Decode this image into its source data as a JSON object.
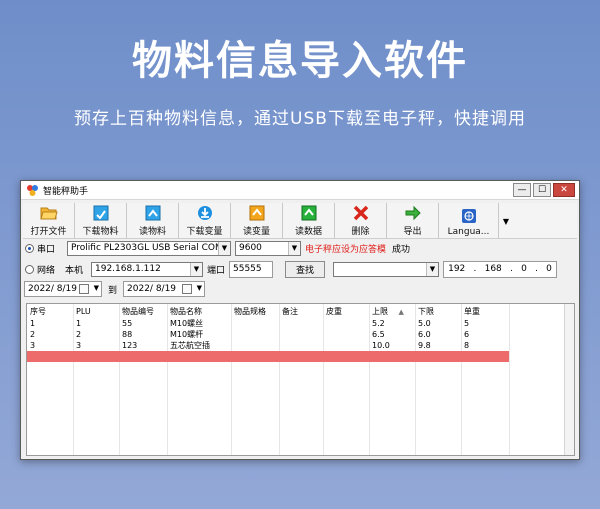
{
  "hero": {
    "title": "物料信息导入软件",
    "subtitle": "预存上百种物料信息，通过USB下载至电子秤，快捷调用"
  },
  "window": {
    "title": "智能秤助手",
    "min_symbol": "—",
    "max_symbol": "☐",
    "close_symbol": "✕"
  },
  "toolbar": {
    "items": [
      {
        "label": "打开文件",
        "icon": "folder-open-icon"
      },
      {
        "label": "下载物料",
        "icon": "download-item-icon"
      },
      {
        "label": "读物料",
        "icon": "read-item-icon"
      },
      {
        "label": "下载变量",
        "icon": "download-variable-icon"
      },
      {
        "label": "读变量",
        "icon": "read-variable-icon"
      },
      {
        "label": "读数据",
        "icon": "read-data-icon"
      },
      {
        "label": "删除",
        "icon": "delete-icon"
      },
      {
        "label": "导出",
        "icon": "export-icon"
      },
      {
        "label": "Langua...",
        "icon": "language-icon"
      }
    ],
    "more_symbol": "▼"
  },
  "serial": {
    "label": "串口",
    "port": "Prolific PL2303GL USB Serial COM Port (",
    "baud": "9600",
    "status_red": "电子秤应设为应答模",
    "status_ok": "成功"
  },
  "network": {
    "label": "网络",
    "local_label": "本机",
    "local_ip": "192.168.1.112",
    "port_label": "端口",
    "port_value": "55555",
    "find_label": "查找",
    "remote_combo": "",
    "ip_parts": [
      "192",
      "168",
      "0",
      "0"
    ]
  },
  "dates": {
    "from": "2022/  8/19",
    "to_label": "到",
    "to": "2022/  8/19"
  },
  "table": {
    "columns": [
      "序号",
      "PLU",
      "物品编号",
      "物品名称",
      "物品规格",
      "备注",
      "皮重",
      "上限",
      "下限",
      "单重"
    ],
    "sort_mark": "▲",
    "rows": [
      [
        "1",
        "1",
        "55",
        "M10螺丝",
        "",
        "",
        "",
        "5.2",
        "5.0",
        "5"
      ],
      [
        "2",
        "2",
        "88",
        "M10螺杆",
        "",
        "",
        "",
        "6.5",
        "6.0",
        "6"
      ],
      [
        "3",
        "3",
        "123",
        "五芯航空插",
        "",
        "",
        "",
        "10.0",
        "9.8",
        "8"
      ]
    ]
  },
  "colors": {
    "highlight_row": "#ee6b6b",
    "status_red": "#e0201b"
  }
}
